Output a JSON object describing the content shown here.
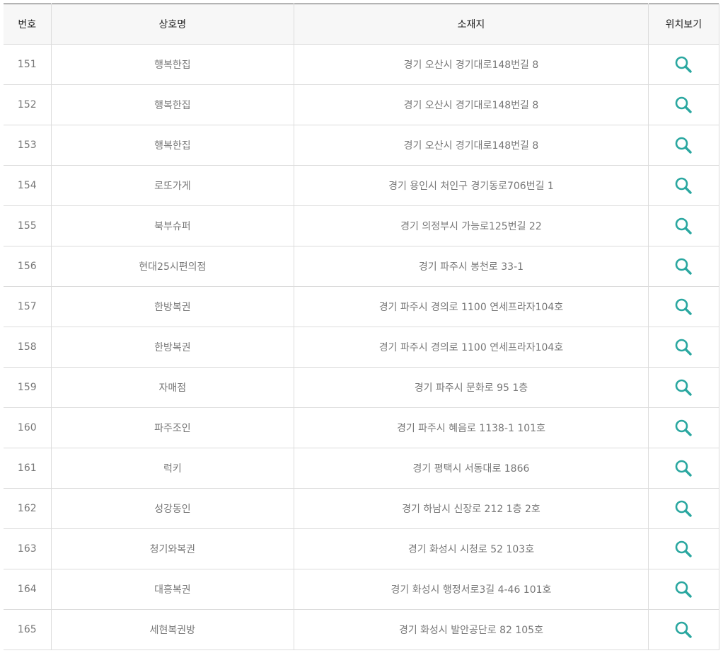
{
  "table": {
    "headers": {
      "no": "번호",
      "name": "상호명",
      "address": "소재지",
      "view": "위치보기"
    },
    "accent_color": "#2aa7a0",
    "view_icon": "magnifier-icon",
    "rows": [
      {
        "no": "151",
        "name": "행복한집",
        "address": "경기 오산시 경기대로148번길 8"
      },
      {
        "no": "152",
        "name": "행복한집",
        "address": "경기 오산시 경기대로148번길 8"
      },
      {
        "no": "153",
        "name": "행복한집",
        "address": "경기 오산시 경기대로148번길 8"
      },
      {
        "no": "154",
        "name": "로또가게",
        "address": "경기 용인시 처인구 경기동로706번길 1"
      },
      {
        "no": "155",
        "name": "북부슈퍼",
        "address": "경기 의정부시 가능로125번길 22"
      },
      {
        "no": "156",
        "name": "현대25시편의점",
        "address": "경기 파주시 봉천로 33-1"
      },
      {
        "no": "157",
        "name": "한방복권",
        "address": "경기 파주시 경의로 1100 연세프라자104호"
      },
      {
        "no": "158",
        "name": "한방복권",
        "address": "경기 파주시 경의로 1100 연세프라자104호"
      },
      {
        "no": "159",
        "name": "자매점",
        "address": "경기 파주시 문화로 95 1층"
      },
      {
        "no": "160",
        "name": "파주조인",
        "address": "경기 파주시 혜음로 1138-1 101호"
      },
      {
        "no": "161",
        "name": "럭키",
        "address": "경기 평택시 서동대로 1866"
      },
      {
        "no": "162",
        "name": "성강동인",
        "address": "경기 하남시 신장로 212 1층 2호"
      },
      {
        "no": "163",
        "name": "청기와복권",
        "address": "경기 화성시 시청로 52 103호"
      },
      {
        "no": "164",
        "name": "대흥복권",
        "address": "경기 화성시 행정서로3길 4-46 101호"
      },
      {
        "no": "165",
        "name": "세현복권방",
        "address": "경기 화성시 발안공단로 82 105호"
      }
    ]
  }
}
